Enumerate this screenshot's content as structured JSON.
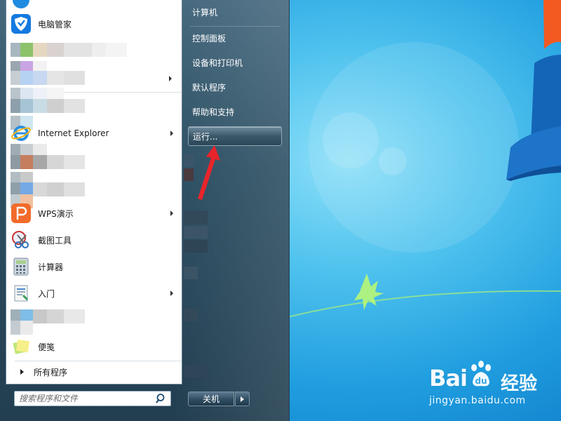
{
  "start_menu": {
    "programs": [
      {
        "label": "电脑管家",
        "icon": "pc-manager-shield-icon",
        "has_submenu": false
      },
      {
        "label": "Internet Explorer",
        "icon": "internet-explorer-icon",
        "has_submenu": true
      },
      {
        "label": "WPS演示",
        "icon": "wps-presentation-icon",
        "has_submenu": true
      },
      {
        "label": "截图工具",
        "icon": "snipping-tool-icon",
        "has_submenu": false
      },
      {
        "label": "计算器",
        "icon": "calculator-icon",
        "has_submenu": false
      },
      {
        "label": "入门",
        "icon": "getting-started-icon",
        "has_submenu": true
      },
      {
        "label": "便笺",
        "icon": "sticky-notes-icon",
        "has_submenu": false
      }
    ],
    "all_programs": "所有程序",
    "search_placeholder": "搜索程序和文件",
    "right_items": [
      {
        "label": "计算机"
      },
      {
        "label": "控制面板"
      },
      {
        "label": "设备和打印机"
      },
      {
        "label": "默认程序"
      },
      {
        "label": "帮助和支持"
      },
      {
        "label": "运行..."
      }
    ],
    "highlighted_item": "运行...",
    "shutdown_label": "关机"
  },
  "watermark": {
    "brand": "Bai",
    "brand_cn": "经验",
    "url": "jingyan.baidu.com"
  },
  "colors": {
    "accent_arrow": "#e8252a",
    "desktop_blue": "#1f9ddf",
    "menu_dark": "#2d5063"
  }
}
